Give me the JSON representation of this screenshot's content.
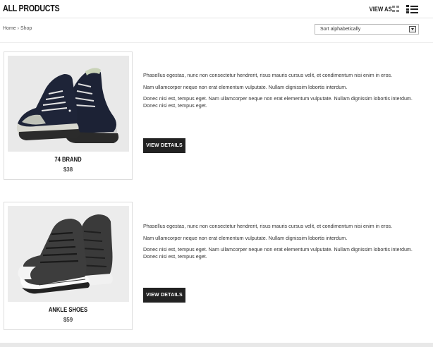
{
  "header": {
    "title": "ALL PRODUCTS",
    "view_as_label": "VIEW AS"
  },
  "breadcrumb": {
    "home": "Home",
    "separator": "›",
    "current": "Shop"
  },
  "sort": {
    "selected": "Sort alphabetically"
  },
  "products": [
    {
      "name": "74 BRAND",
      "price": "$38",
      "description": [
        "Phasellus egestas, nunc non consectetur hendrerit, risus mauris cursus velit, et condimentum nisi enim in eros.",
        "Nam ullamcorper neque non erat elementum vulputate. Nullam dignissim lobortis interdum.",
        "Donec nisi est, tempus eget. Nam ullamcorper neque non erat elementum vulputate. Nullam dignissim lobortis interdum. Donec nisi est, tempus eget."
      ],
      "button_label": "VIEW DETAILS"
    },
    {
      "name": "ANKLE SHOES",
      "price": "$59",
      "description": [
        "Phasellus egestas, nunc non consectetur hendrerit, risus mauris cursus velit, et condimentum nisi enim in eros.",
        "Nam ullamcorper neque non erat elementum vulputate. Nullam dignissim lobortis interdum.",
        "Donec nisi est, tempus eget. Nam ullamcorper neque non erat elementum vulputate. Nullam dignissim lobortis interdum. Donec nisi est, tempus eget."
      ],
      "button_label": "VIEW DETAILS"
    }
  ]
}
